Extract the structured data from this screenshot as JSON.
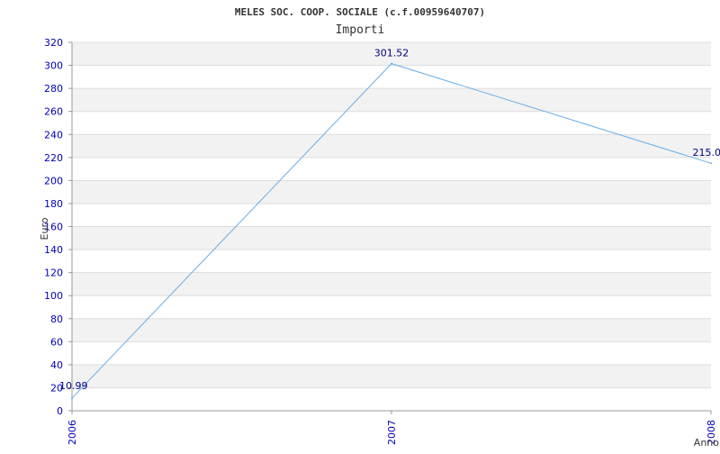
{
  "chart_data": {
    "type": "line",
    "title": "MELES SOC. COOP. SOCIALE (c.f.00959640707)",
    "subtitle": "Importi",
    "xlabel": "Anno",
    "ylabel": "Euro",
    "categories": [
      "2006",
      "2007",
      "2008"
    ],
    "series": [
      {
        "values": [
          10.99,
          301.52,
          215.0
        ],
        "labels": [
          "10.99",
          "301.52",
          "215.0"
        ]
      }
    ],
    "ylim": [
      0,
      320
    ],
    "yticks": [
      "0",
      "20",
      "40",
      "60",
      "80",
      "100",
      "120",
      "140",
      "160",
      "180",
      "200",
      "220",
      "240",
      "260",
      "280",
      "300",
      "320"
    ],
    "grid": "horizontal alternating bands",
    "colors": {
      "line": "#6aaee8",
      "band": "#f2f2f2",
      "grid": "#dddddd",
      "tick_text": "#0000bb",
      "data_label": "#000080"
    }
  }
}
